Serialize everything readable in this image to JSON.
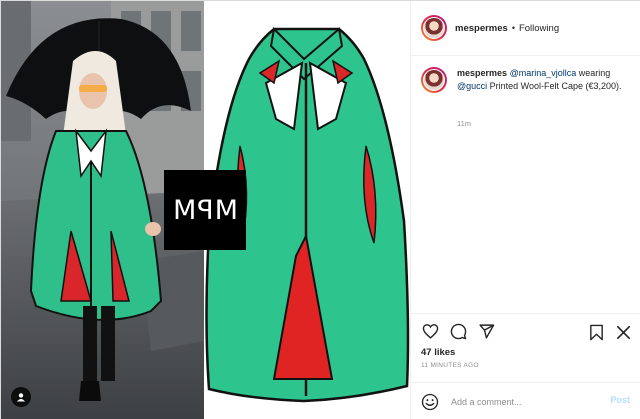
{
  "post": {
    "username": "mespermes",
    "follow_separator": "•",
    "follow_status": "Following",
    "caption": {
      "username": "mespermes",
      "mention_1": "@marina_vjollca",
      "text_1": " wearing",
      "mention_2": "@gucci",
      "text_2": " Printed Wool-Felt Cape (€3,200)."
    },
    "caption_time": "11m",
    "likes": "47 likes",
    "posted_time": "11 MINUTES AGO",
    "comment_placeholder": "Add a comment...",
    "post_label": "Post"
  },
  "media": {
    "watermark_text": "MPM"
  },
  "icons": {
    "like": "heart-icon",
    "comment": "comment-icon",
    "share": "share-icon",
    "save": "bookmark-icon",
    "more": "more-icon",
    "emoji": "emoji-icon",
    "tag": "user-tag-icon"
  },
  "colors": {
    "cape_green": "#2ec48e",
    "cape_red": "#e02424",
    "link": "#00376b",
    "post_disabled": "#b2dffc"
  }
}
